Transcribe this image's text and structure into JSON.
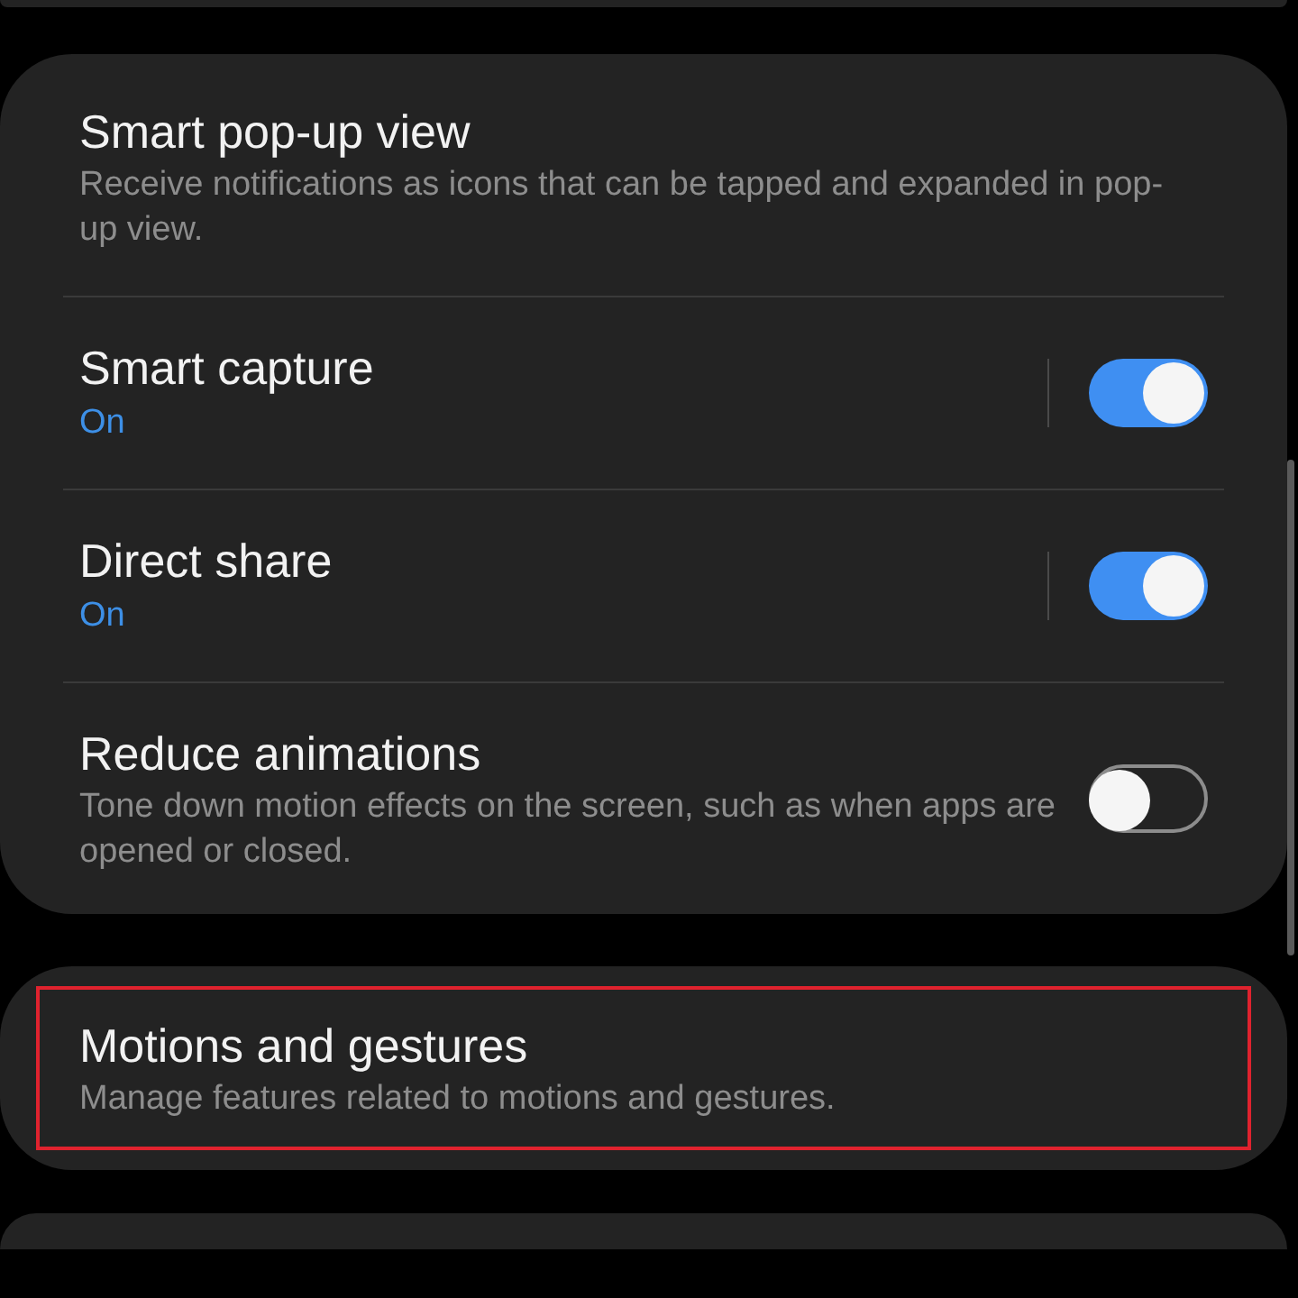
{
  "sections": [
    {
      "items": [
        {
          "kind": "plain",
          "title": "Smart pop-up view",
          "description": "Receive notifications as icons that can be tapped and expanded in pop-up view."
        },
        {
          "kind": "switch",
          "title": "Smart capture",
          "status": "On",
          "on": true,
          "split": true
        },
        {
          "kind": "switch",
          "title": "Direct share",
          "status": "On",
          "on": true,
          "split": true
        },
        {
          "kind": "switch",
          "title": "Reduce animations",
          "description": "Tone down motion effects on the screen, such as when apps are opened or closed.",
          "on": false,
          "split": false
        }
      ]
    },
    {
      "items": [
        {
          "kind": "plain",
          "title": "Motions and gestures",
          "description": "Manage features related to motions and gestures.",
          "highlighted": true
        }
      ]
    }
  ]
}
